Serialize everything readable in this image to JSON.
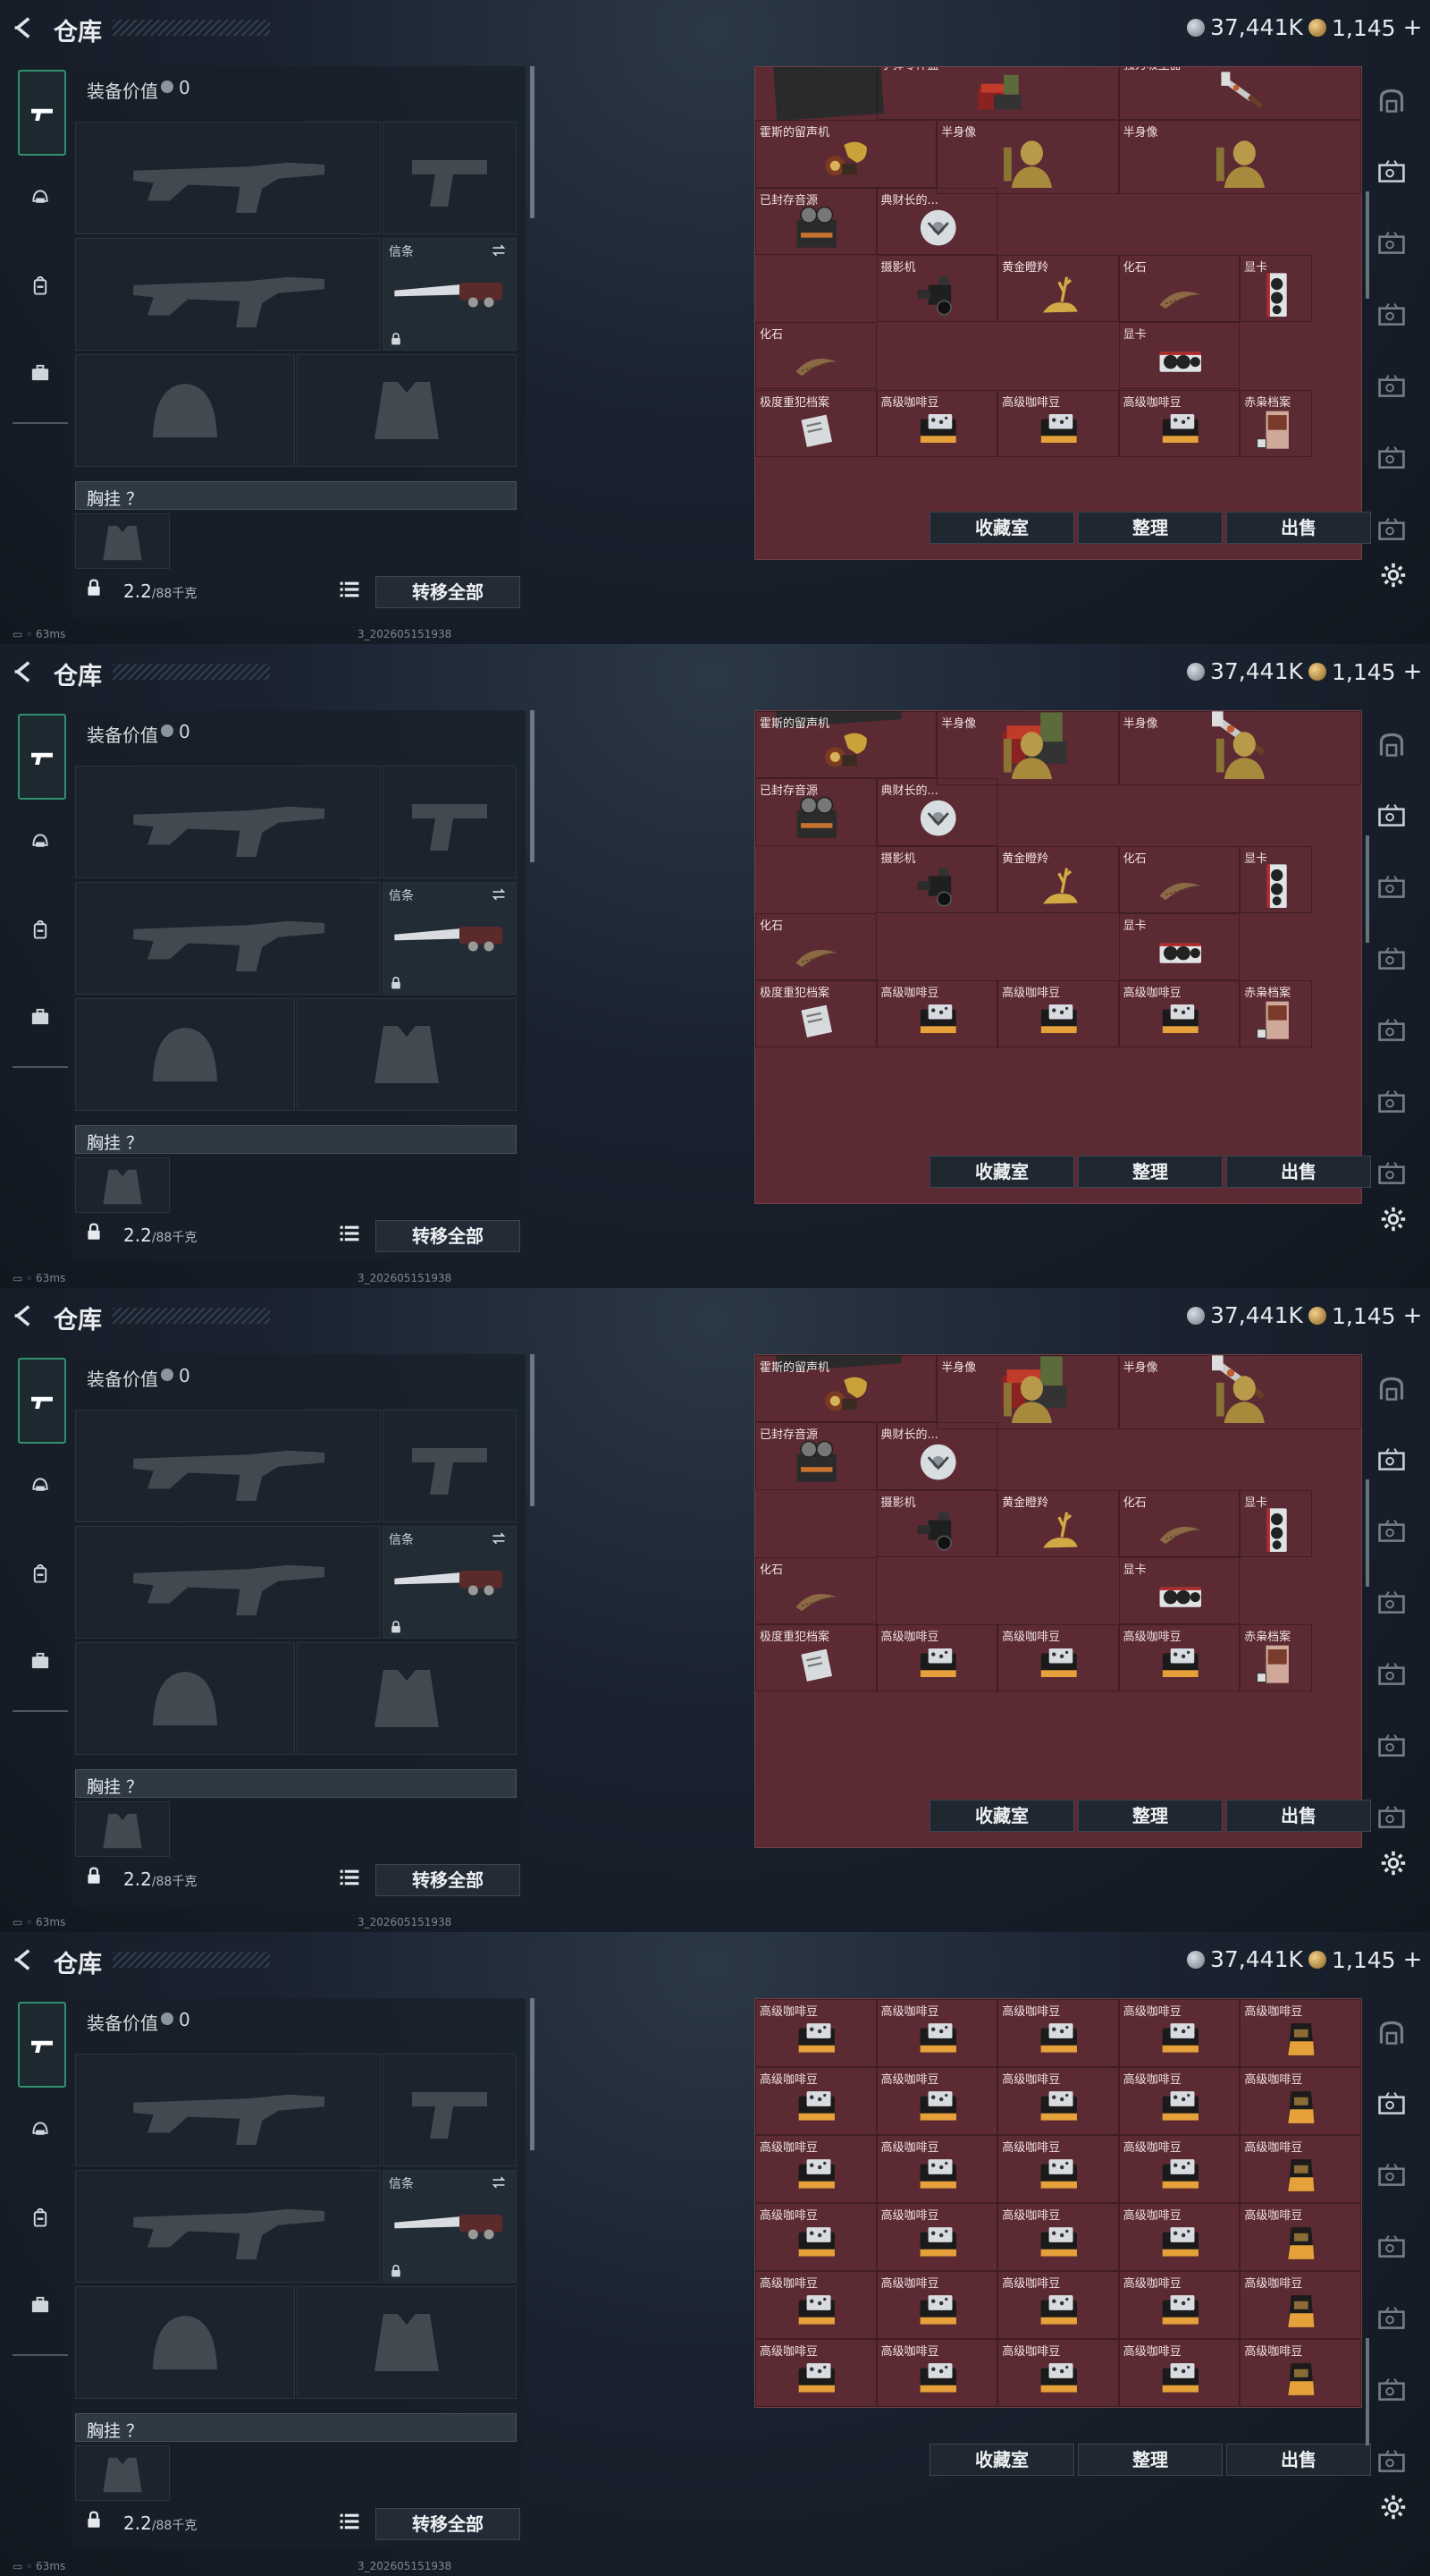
{
  "header": {
    "title": "仓库",
    "silver": "37,441K",
    "gold": "1,145",
    "plus": "+"
  },
  "loadout": {
    "equip_value_label": "装备价值",
    "equip_value": "0",
    "melee_label": "信条",
    "chest_label": "胸挂 ？",
    "weight": "2.2",
    "weight_cap": "/88千克",
    "transfer_all": "转移全部"
  },
  "buttons": {
    "collection": "收藏室",
    "organize": "整理",
    "sell": "出售"
  },
  "status": {
    "ping": "63ms",
    "build": "3_202605151938"
  },
  "icon_names": [
    "back-icon",
    "silver-coin-icon",
    "gold-coin-icon",
    "gun-icon",
    "helmet-icon",
    "backpack-icon",
    "briefcase-icon",
    "list-icon",
    "gear-icon",
    "lock-icon",
    "swap-icon"
  ],
  "frames": [
    {
      "items": [
        {
          "label": "子弹零件盒",
          "icon": "ammo-parts-box"
        },
        {
          "label": "强力吸尘器",
          "icon": "vacuum"
        },
        {
          "label": "霍斯的留声机",
          "icon": "gramophone"
        },
        {
          "label": "半身像",
          "icon": "bust"
        },
        {
          "label": "半身像",
          "icon": "bust"
        },
        {
          "label": "已封存音源",
          "icon": "reel-recorder"
        },
        {
          "label": "典财长的...",
          "icon": "disc"
        },
        {
          "label": "摄影机",
          "icon": "camera"
        },
        {
          "label": "黄金瞪羚",
          "icon": "gazelle"
        },
        {
          "label": "化石",
          "icon": "fossil"
        },
        {
          "label": "显卡",
          "icon": "gpu"
        },
        {
          "label": "化石",
          "icon": "fossil"
        },
        {
          "label": "显卡",
          "icon": "gpu"
        },
        {
          "label": "极度重犯档案",
          "icon": "file"
        },
        {
          "label": "高级咖啡豆",
          "icon": "coffee"
        },
        {
          "label": "高级咖啡豆",
          "icon": "coffee"
        },
        {
          "label": "高级咖啡豆",
          "icon": "coffee"
        },
        {
          "label": "赤枭档案",
          "icon": "dossier"
        }
      ]
    },
    {
      "items": [
        {
          "label": "霍斯的留声机",
          "icon": "gramophone"
        },
        {
          "label": "半身像",
          "icon": "bust"
        },
        {
          "label": "半身像",
          "icon": "bust"
        },
        {
          "label": "已封存音源",
          "icon": "reel-recorder"
        },
        {
          "label": "典财长的...",
          "icon": "disc"
        },
        {
          "label": "摄影机",
          "icon": "camera"
        },
        {
          "label": "黄金瞪羚",
          "icon": "gazelle"
        },
        {
          "label": "化石",
          "icon": "fossil"
        },
        {
          "label": "显卡",
          "icon": "gpu"
        },
        {
          "label": "化石",
          "icon": "fossil"
        },
        {
          "label": "显卡",
          "icon": "gpu"
        },
        {
          "label": "极度重犯档案",
          "icon": "file"
        },
        {
          "label": "高级咖啡豆",
          "icon": "coffee"
        },
        {
          "label": "高级咖啡豆",
          "icon": "coffee"
        },
        {
          "label": "高级咖啡豆",
          "icon": "coffee"
        },
        {
          "label": "赤枭档案",
          "icon": "dossier"
        }
      ]
    },
    {
      "items": [
        {
          "label": "霍斯的留声机",
          "icon": "gramophone"
        },
        {
          "label": "半身像",
          "icon": "bust"
        },
        {
          "label": "半身像",
          "icon": "bust"
        },
        {
          "label": "已封存音源",
          "icon": "reel-recorder"
        },
        {
          "label": "典财长的...",
          "icon": "disc"
        },
        {
          "label": "摄影机",
          "icon": "camera"
        },
        {
          "label": "黄金瞪羚",
          "icon": "gazelle"
        },
        {
          "label": "化石",
          "icon": "fossil"
        },
        {
          "label": "显卡",
          "icon": "gpu"
        },
        {
          "label": "化石",
          "icon": "fossil"
        },
        {
          "label": "显卡",
          "icon": "gpu"
        },
        {
          "label": "极度重犯档案",
          "icon": "file"
        },
        {
          "label": "高级咖啡豆",
          "icon": "coffee"
        },
        {
          "label": "高级咖啡豆",
          "icon": "coffee"
        },
        {
          "label": "高级咖啡豆",
          "icon": "coffee"
        },
        {
          "label": "赤枭档案",
          "icon": "dossier"
        }
      ]
    },
    {
      "coffee_label": "高级咖啡豆",
      "coffee_rows": 6,
      "coffee_cols": 5
    }
  ]
}
